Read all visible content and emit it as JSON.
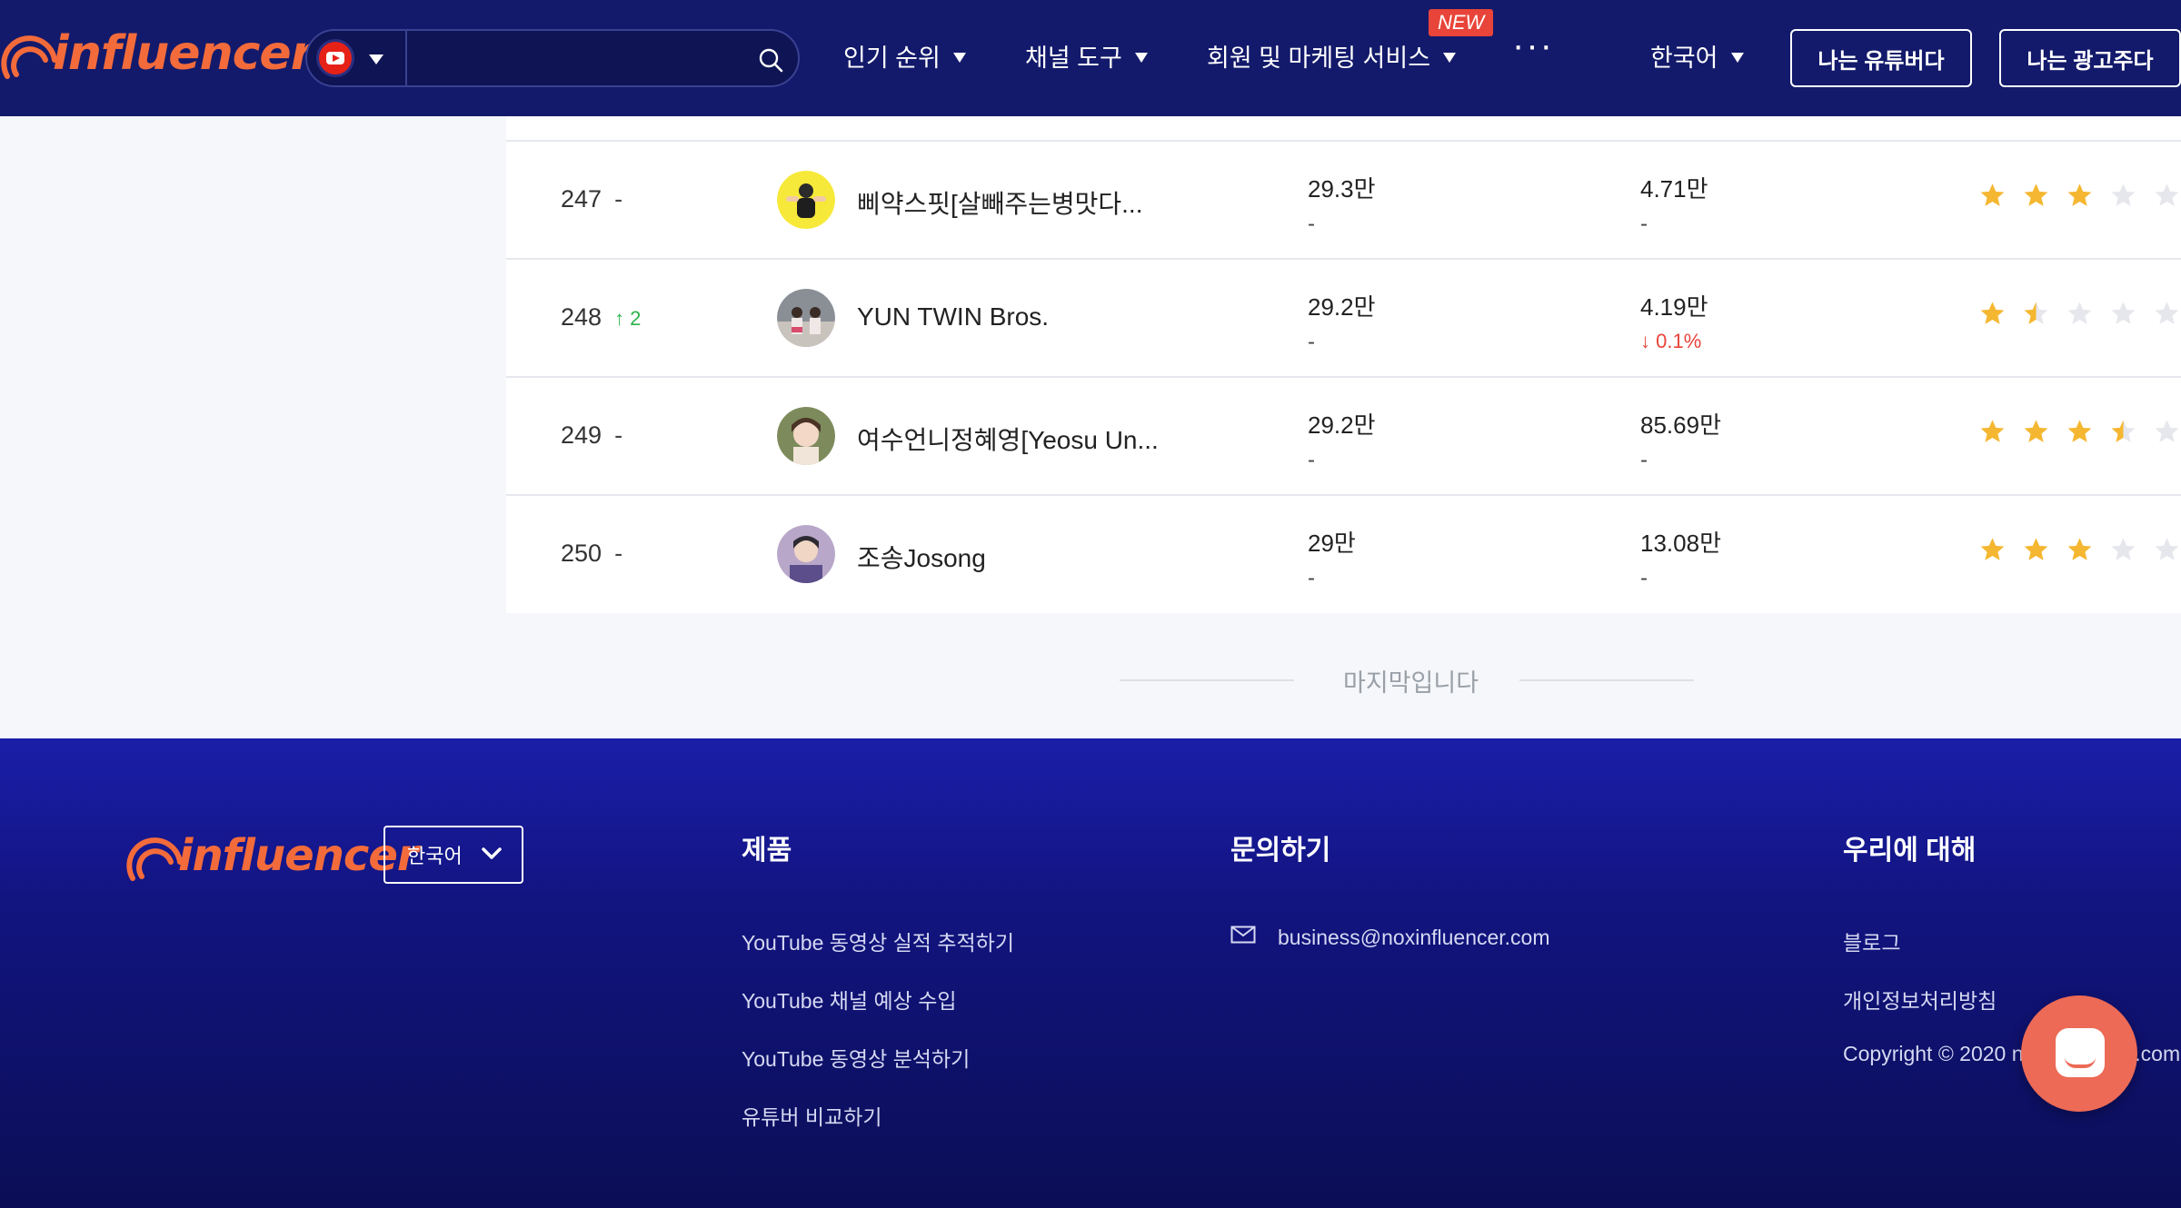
{
  "header": {
    "logo_text": "influencer",
    "platform_icon": "youtube-icon",
    "search_placeholder": "",
    "nav": [
      {
        "label": "인기 순위"
      },
      {
        "label": "채널 도구"
      },
      {
        "label": "회원 및 마케팅 서비스",
        "badge": "NEW"
      },
      {
        "label": "···"
      }
    ],
    "language": "한국어",
    "btn_youtuber": "나는 유튜버다",
    "btn_advertiser": "나는 광고주다"
  },
  "rows": [
    {
      "rank": "247",
      "change": "-",
      "name": "삐약스핏[살빼주는병맛다...",
      "subs": "29.3만",
      "subs_change": "-",
      "views": "4.71만",
      "views_change": "-",
      "rating": 3
    },
    {
      "rank": "248",
      "change": "↑ 2",
      "name": "YUN TWIN Bros.",
      "subs": "29.2만",
      "subs_change": "-",
      "views": "4.19만",
      "views_change": "↓ 0.1%",
      "rating": 1.5
    },
    {
      "rank": "249",
      "change": "-",
      "name": "여수언니정혜영[Yeosu Un...",
      "subs": "29.2만",
      "subs_change": "-",
      "views": "85.69만",
      "views_change": "-",
      "rating": 3.5
    },
    {
      "rank": "250",
      "change": "-",
      "name": "조송Josong",
      "subs": "29만",
      "subs_change": "-",
      "views": "13.08만",
      "views_change": "-",
      "rating": 3
    }
  ],
  "end_message": "마지막입니다",
  "footer": {
    "logo_text": "influencer",
    "language": "한국어",
    "products_title": "제품",
    "products": [
      "YouTube 동영상 실적 추적하기",
      "YouTube 채널 예상 수입",
      "YouTube 동영상 분석하기",
      "유튜버 비교하기"
    ],
    "contact_title": "문의하기",
    "email": "business@noxinfluencer.com",
    "about_title": "우리에 대해",
    "about_links": [
      "블로그",
      "개인정보처리방침"
    ],
    "copyright": "Copyright © 2020 noxinfluencer.com"
  },
  "colors": {
    "header_bg": "#131a6b",
    "brand_orange": "#f36b3b",
    "star_gold": "#f5b731",
    "up_green": "#2db34a",
    "down_red": "#e8443a"
  }
}
